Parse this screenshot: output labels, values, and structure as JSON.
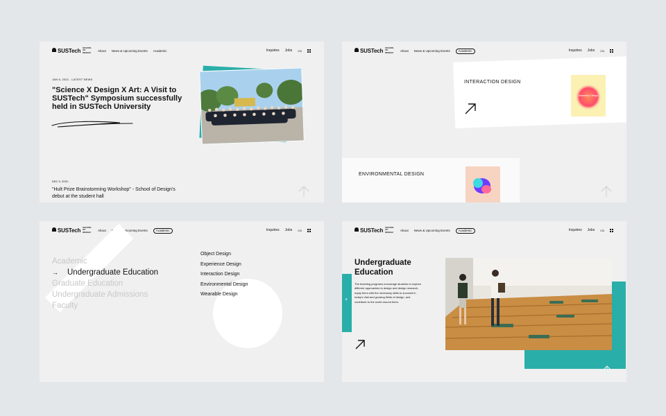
{
  "nav": {
    "logo_text": "SUSTech",
    "logo_sub": "SCHOOL OF DESIGN",
    "links": [
      "About",
      "News & Upcoming Events",
      "Academic"
    ],
    "right": [
      "Inquiries",
      "Jobs",
      "CN"
    ]
  },
  "panel1": {
    "meta": "JAN 6, 2021 - LATEST NEWS",
    "title": "\"Science X Design X Art: A Visit to SUSTech\" Symposium successfully held in SUSTech University",
    "meta2": "DEC 9, 2020 -",
    "title2": "\"Hult Prize Brainstorming Workshop\" - School of Design's debut at the student hall"
  },
  "panel2": {
    "card1_label": "INTERACTION DESIGN",
    "card1_thumb": "Interaction Design",
    "card2_label": "ENVIRONMENTAL DESIGN"
  },
  "panel3": {
    "menu": [
      "Academic",
      "Undergraduate Education",
      "Graduate Education",
      "Undergraduate Admissions",
      "Faculty"
    ],
    "active_index": 1,
    "sub": [
      "Object Design",
      "Experience Design",
      "Interaction Design",
      "Environmental Design",
      "Wearable Design"
    ]
  },
  "panel4": {
    "title": "Undergraduate Education",
    "body": "The teaching programs encourage students to explore different approaches to design and design research, equip them with the necessary skills to succeed in today's vital and growing fields of design, and contribute to the world around them."
  },
  "colors": {
    "accent": "#2aaea9",
    "panel_bg": "#f0f0f0",
    "page_bg": "#e4e7ea"
  },
  "icons": [
    "grid-menu-icon",
    "arrow-up-icon",
    "arrow-up-right-icon",
    "arrow-right-icon",
    "plus-icon"
  ]
}
